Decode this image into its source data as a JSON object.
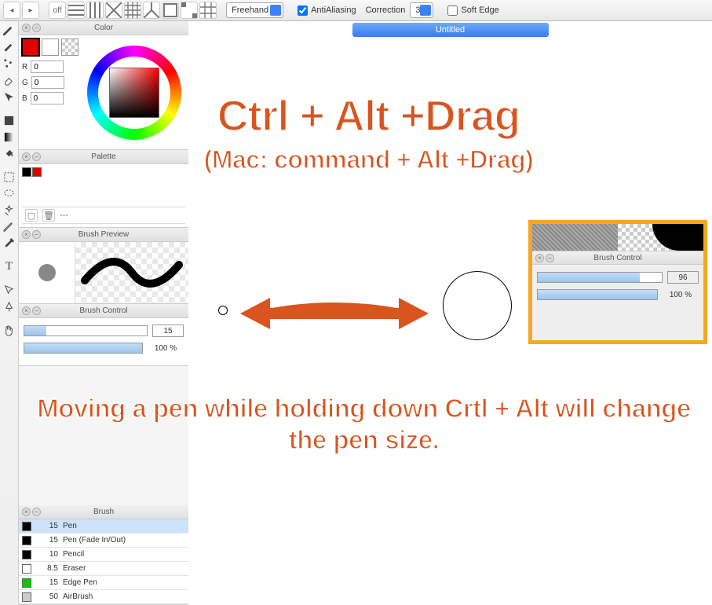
{
  "toolbar": {
    "off_label": "off",
    "mode_dropdown": "Freehand",
    "antialiasing_label": "AntiAliasing",
    "antialiasing_checked": true,
    "correction_label": "Correction",
    "correction_value": "3",
    "softedge_label": "Soft Edge",
    "softedge_checked": false
  },
  "document": {
    "tab_title": "Untitled"
  },
  "panels": {
    "color": {
      "title": "Color",
      "r_label": "R",
      "r_val": "0",
      "g_label": "G",
      "g_val": "0",
      "b_label": "B",
      "b_val": "0"
    },
    "palette": {
      "title": "Palette",
      "path": "---"
    },
    "preview": {
      "title": "Brush Preview"
    },
    "control": {
      "title": "Brush Control",
      "size_val": "15",
      "opacity_val": "100 %",
      "size_pct": 18,
      "opacity_pct": 100
    },
    "brush": {
      "title": "Brush",
      "items": [
        {
          "color": "#000",
          "size": "15",
          "name": "Pen",
          "sel": true
        },
        {
          "color": "#000",
          "size": "15",
          "name": "Pen (Fade In/Out)"
        },
        {
          "color": "#000",
          "size": "10",
          "name": "Pencil"
        },
        {
          "color": "#fff",
          "size": "8.5",
          "name": "Eraser"
        },
        {
          "color": "#0c0",
          "size": "15",
          "name": "Edge Pen"
        },
        {
          "color": "#ccc",
          "size": "50",
          "name": "AirBrush"
        }
      ]
    }
  },
  "inset": {
    "title": "Brush Control",
    "size_val": "96",
    "opacity_val": "100 %",
    "size_pct": 82,
    "opacity_pct": 100
  },
  "tutorial": {
    "title": "Ctrl + Alt +Drag",
    "subtitle": "(Mac: command + Alt +Drag)",
    "body": "Moving a pen while holding down Crtl + Alt will change the pen size."
  }
}
